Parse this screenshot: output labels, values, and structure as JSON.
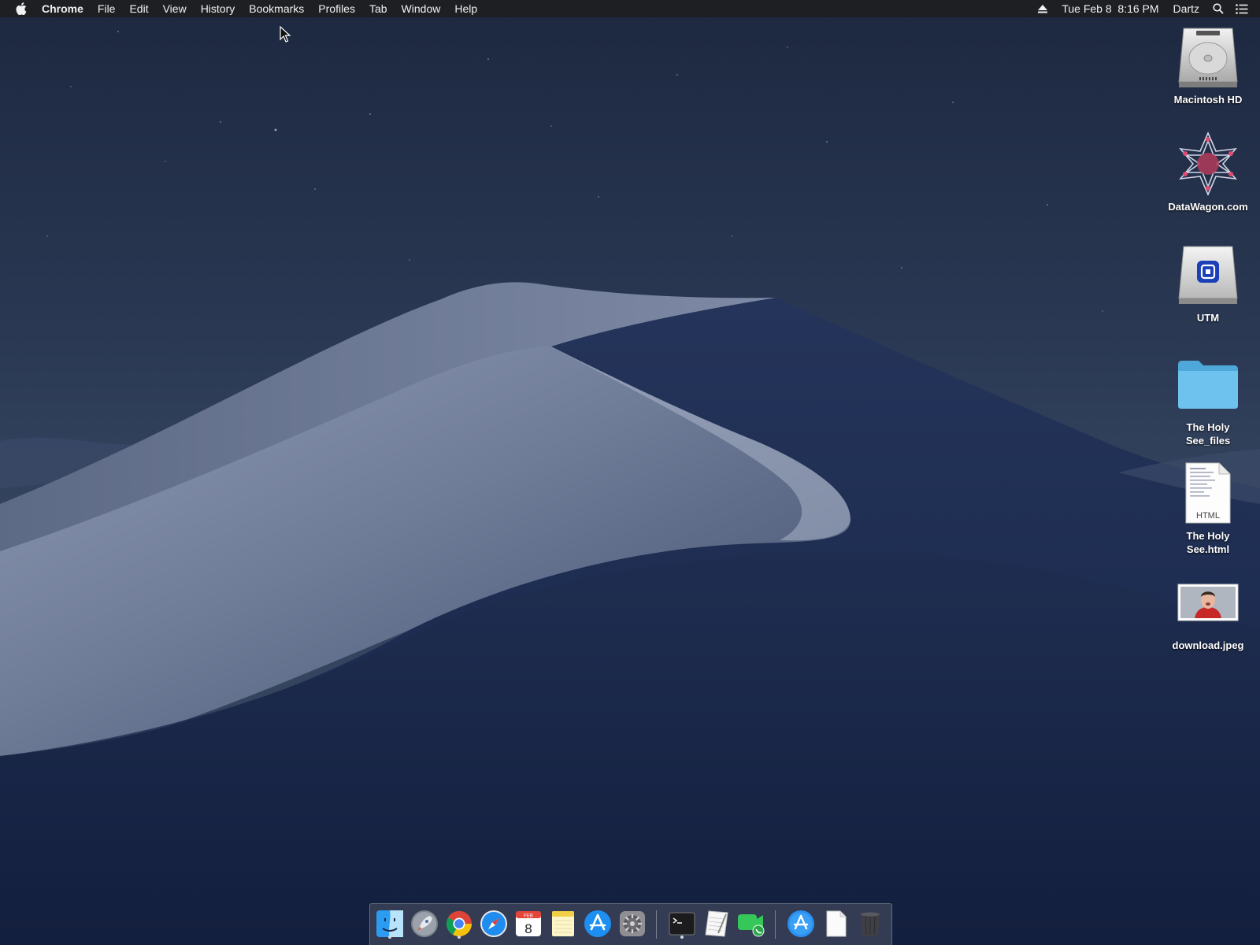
{
  "menubar": {
    "apple_icon": "apple-logo-icon",
    "app_name": "Chrome",
    "items": [
      "File",
      "Edit",
      "View",
      "History",
      "Bookmarks",
      "Profiles",
      "Tab",
      "Window",
      "Help"
    ],
    "datetime": "Tue Feb 8  8:16 PM",
    "user": "Dartz",
    "status_icons": [
      "eject-icon",
      "spotlight-search-icon",
      "notification-center-icon"
    ]
  },
  "desktop": {
    "icons": [
      {
        "label": "Macintosh HD",
        "icon": "hard-drive-icon"
      },
      {
        "label": "DataWagon.com",
        "icon": "datawagon-logo-icon"
      },
      {
        "label": "UTM",
        "icon": "utm-disk-icon"
      },
      {
        "label": "The Holy See_files",
        "icon": "folder-icon"
      },
      {
        "label": "The Holy See.html",
        "icon": "html-document-icon",
        "badge": "HTML"
      },
      {
        "label": "download.jpeg",
        "icon": "image-thumbnail-icon"
      }
    ]
  },
  "dock": {
    "apps": [
      {
        "name": "Finder",
        "icon": "finder-icon",
        "running": true
      },
      {
        "name": "Launchpad",
        "icon": "launchpad-rocket-icon",
        "running": false
      },
      {
        "name": "Google Chrome",
        "icon": "chrome-icon",
        "running": true
      },
      {
        "name": "Safari",
        "icon": "safari-compass-icon",
        "running": false
      },
      {
        "name": "Calendar",
        "icon": "calendar-icon",
        "running": false,
        "month": "FEB",
        "day": "8"
      },
      {
        "name": "Notes",
        "icon": "notes-icon",
        "running": false
      },
      {
        "name": "App Store",
        "icon": "app-store-icon",
        "running": false
      },
      {
        "name": "System Preferences",
        "icon": "system-preferences-gear-icon",
        "running": false
      },
      {
        "name": "Terminal",
        "icon": "terminal-icon",
        "running": true
      },
      {
        "name": "TextEdit",
        "icon": "textedit-icon",
        "running": false
      },
      {
        "name": "FaceTime",
        "icon": "facetime-icon",
        "running": false
      },
      {
        "name": "Applications",
        "icon": "applications-folder-icon",
        "running": false
      },
      {
        "name": "Documents",
        "icon": "document-stack-icon",
        "running": false
      },
      {
        "name": "Trash",
        "icon": "trash-icon",
        "running": false
      }
    ]
  },
  "colors": {
    "menubar_bg": "#1e1e20",
    "sky_top": "#1f2b42",
    "dune_light": "#9aa6be",
    "dune_shadow": "#1b284a",
    "folder_blue": "#58b6e6"
  }
}
